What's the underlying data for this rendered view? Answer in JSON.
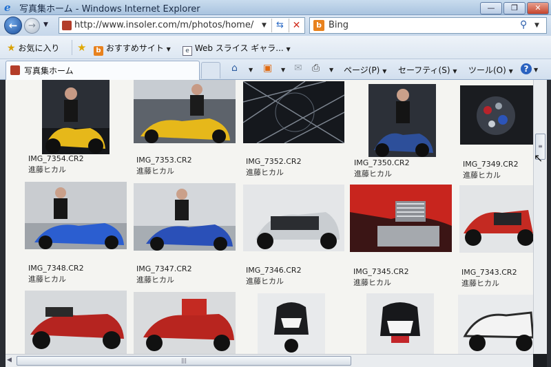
{
  "window": {
    "title": "写真集ホーム - Windows Internet Explorer",
    "min_label": "—",
    "max_label": "❐",
    "close_label": "✕"
  },
  "address_bar": {
    "url": "http://www.insoler.com/m/photos/home/",
    "search_value": "Bing"
  },
  "favorites_bar": {
    "favorites_label": "お気に入り",
    "suggested_sites_label": "おすすめサイト",
    "web_slice_label": "Web スライス ギャラ..."
  },
  "tab": {
    "title": "写真集ホーム"
  },
  "command_bar": {
    "page_label": "ページ(P)",
    "safety_label": "セーフティ(S)",
    "tools_label": "ツール(O)",
    "help_label": "?"
  },
  "photos": {
    "row1": [
      {
        "filename": "IMG_7354.CR2",
        "owner": "進藤ヒカル"
      },
      {
        "filename": "IMG_7353.CR2",
        "owner": "進藤ヒカル"
      },
      {
        "filename": "IMG_7352.CR2",
        "owner": "進藤ヒカル"
      },
      {
        "filename": "IMG_7350.CR2",
        "owner": "進藤ヒカル"
      },
      {
        "filename": "IMG_7349.CR2",
        "owner": "進藤ヒカル"
      }
    ],
    "row2": [
      {
        "filename": "IMG_7348.CR2",
        "owner": "進藤ヒカル"
      },
      {
        "filename": "IMG_7347.CR2",
        "owner": "進藤ヒカル"
      },
      {
        "filename": "IMG_7346.CR2",
        "owner": "進藤ヒカル"
      },
      {
        "filename": "IMG_7345.CR2",
        "owner": "進藤ヒカル"
      },
      {
        "filename": "IMG_7343.CR2",
        "owner": "進藤ヒカル"
      }
    ]
  },
  "colors": {
    "bing_orange": "#e8821e",
    "ie_blue": "#1f6fd1",
    "close_red": "#c5442c"
  }
}
